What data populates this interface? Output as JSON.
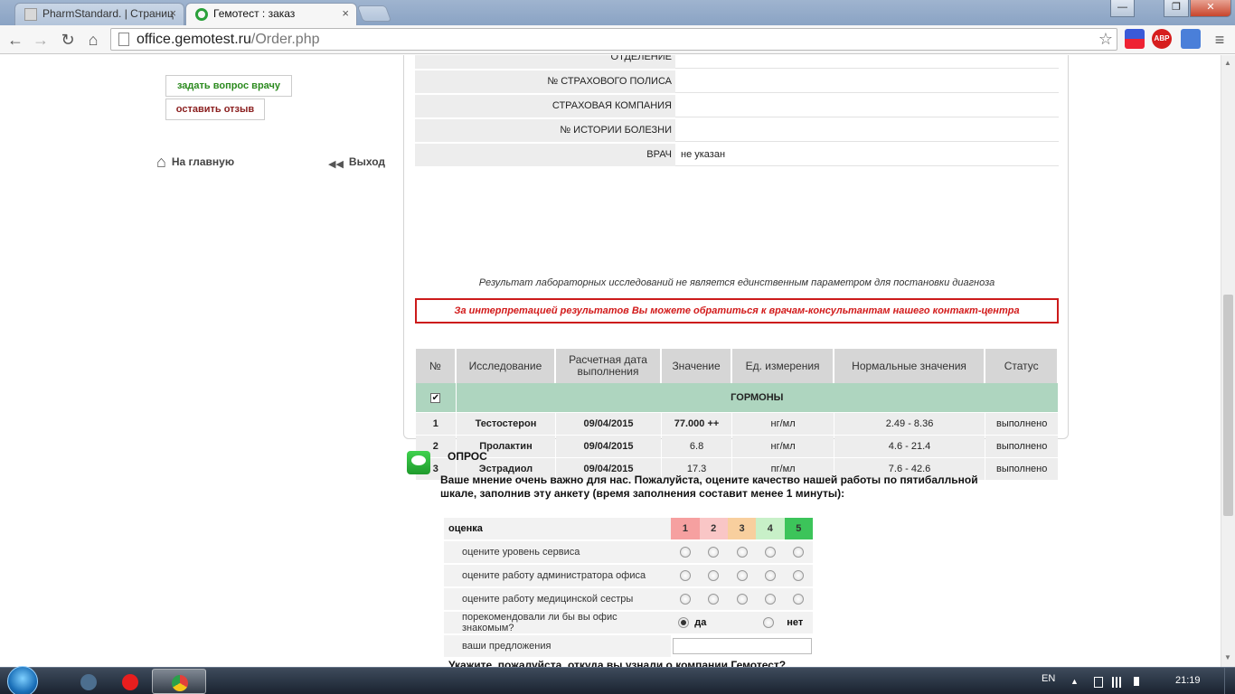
{
  "browser": {
    "tabs": [
      {
        "title": "PharmStandard. | Страниц",
        "active": false
      },
      {
        "title": "Гемотест : заказ",
        "active": true
      }
    ],
    "close_glyph": "×",
    "url_host": "office.gemotest.ru",
    "url_path": "/Order.php",
    "window_buttons": {
      "minimize": "—",
      "restore": "❐",
      "close": "✕"
    },
    "nav": {
      "back": "←",
      "forward": "→",
      "reload": "↻",
      "home": "⌂",
      "star": "☆",
      "menu": "≡"
    },
    "extensions": [
      "flag-icon",
      "adblock-icon",
      "translate-icon"
    ],
    "adblock_label": "ABP"
  },
  "sidebar": {
    "ask_doctor": "задать вопрос врачу",
    "feedback": "оставить отзыв",
    "home_link": "На главную",
    "logout_link": "Выход",
    "home_glyph": "⌂",
    "logout_glyph": "◀◀"
  },
  "patient_info": [
    {
      "label": "ОТДЕЛЕНИЕ",
      "value": ""
    },
    {
      "label": "№ СТРАХОВОГО ПОЛИСА",
      "value": ""
    },
    {
      "label": "СТРАХОВАЯ КОМПАНИЯ",
      "value": ""
    },
    {
      "label": "№ ИСТОРИИ БОЛЕЗНИ",
      "value": ""
    },
    {
      "label": "ВРАЧ",
      "value": "не указан"
    }
  ],
  "disclaimer": "Результат лабораторных исследований не является единственным параметром для постановки диагноза",
  "warning": "За интерпретацией результатов Вы можете обратиться к врачам-консультантам нашего контакт-центра",
  "results": {
    "headers": [
      "№",
      "Исследование",
      "Расчетная дата выполнения",
      "Значение",
      "Ед. измерения",
      "Нормальные значения",
      "Статус"
    ],
    "group": {
      "name": "ГОРМОНЫ",
      "checked": "✔"
    },
    "rows": [
      {
        "n": "1",
        "test": "Тестостерон",
        "date": "09/04/2015",
        "value": "77.000 ++",
        "unit": "нг/мл",
        "norm": "2.49 - 8.36",
        "status": "выполнено"
      },
      {
        "n": "2",
        "test": "Пролактин",
        "date": "09/04/2015",
        "value": "6.8",
        "unit": "нг/мл",
        "norm": "4.6 - 21.4",
        "status": "выполнено"
      },
      {
        "n": "3",
        "test": "Эстрадиол",
        "date": "09/04/2015",
        "value": "17.3",
        "unit": "пг/мл",
        "norm": "7.6 - 42.6",
        "status": "выполнено"
      }
    ]
  },
  "survey": {
    "title": "ОПРОС",
    "intro": "Ваше мнение очень важно для нас. Пожалуйста, оцените качество нашей работы по пятибалльной шкале, заполнив эту анкету (время заполнения составит менее 1 минуты):",
    "header_label": "оценка",
    "grades": [
      "1",
      "2",
      "3",
      "4",
      "5"
    ],
    "grade_colors": [
      "#f6a0a0",
      "#f9c6c6",
      "#f8cf9e",
      "#c8f0c8",
      "#3cc45a"
    ],
    "questions": [
      "оцените уровень сервиса",
      "оцените работу администратора офиса",
      "оцените работу медицинской сестры"
    ],
    "recommend_question": "порекомендовали ли бы вы офис знакомым?",
    "yes": "да",
    "no": "нет",
    "suggestions_label": "ваши предложения",
    "suggestions_value": "",
    "next_question": "Укажите, пожалуйста, откуда вы узнали о компании Гемотест?"
  },
  "taskbar": {
    "language": "EN",
    "clock": "21:19",
    "apps": [
      "media-icon",
      "yandex-icon",
      "chrome-icon"
    ],
    "tray_up": "▲"
  }
}
